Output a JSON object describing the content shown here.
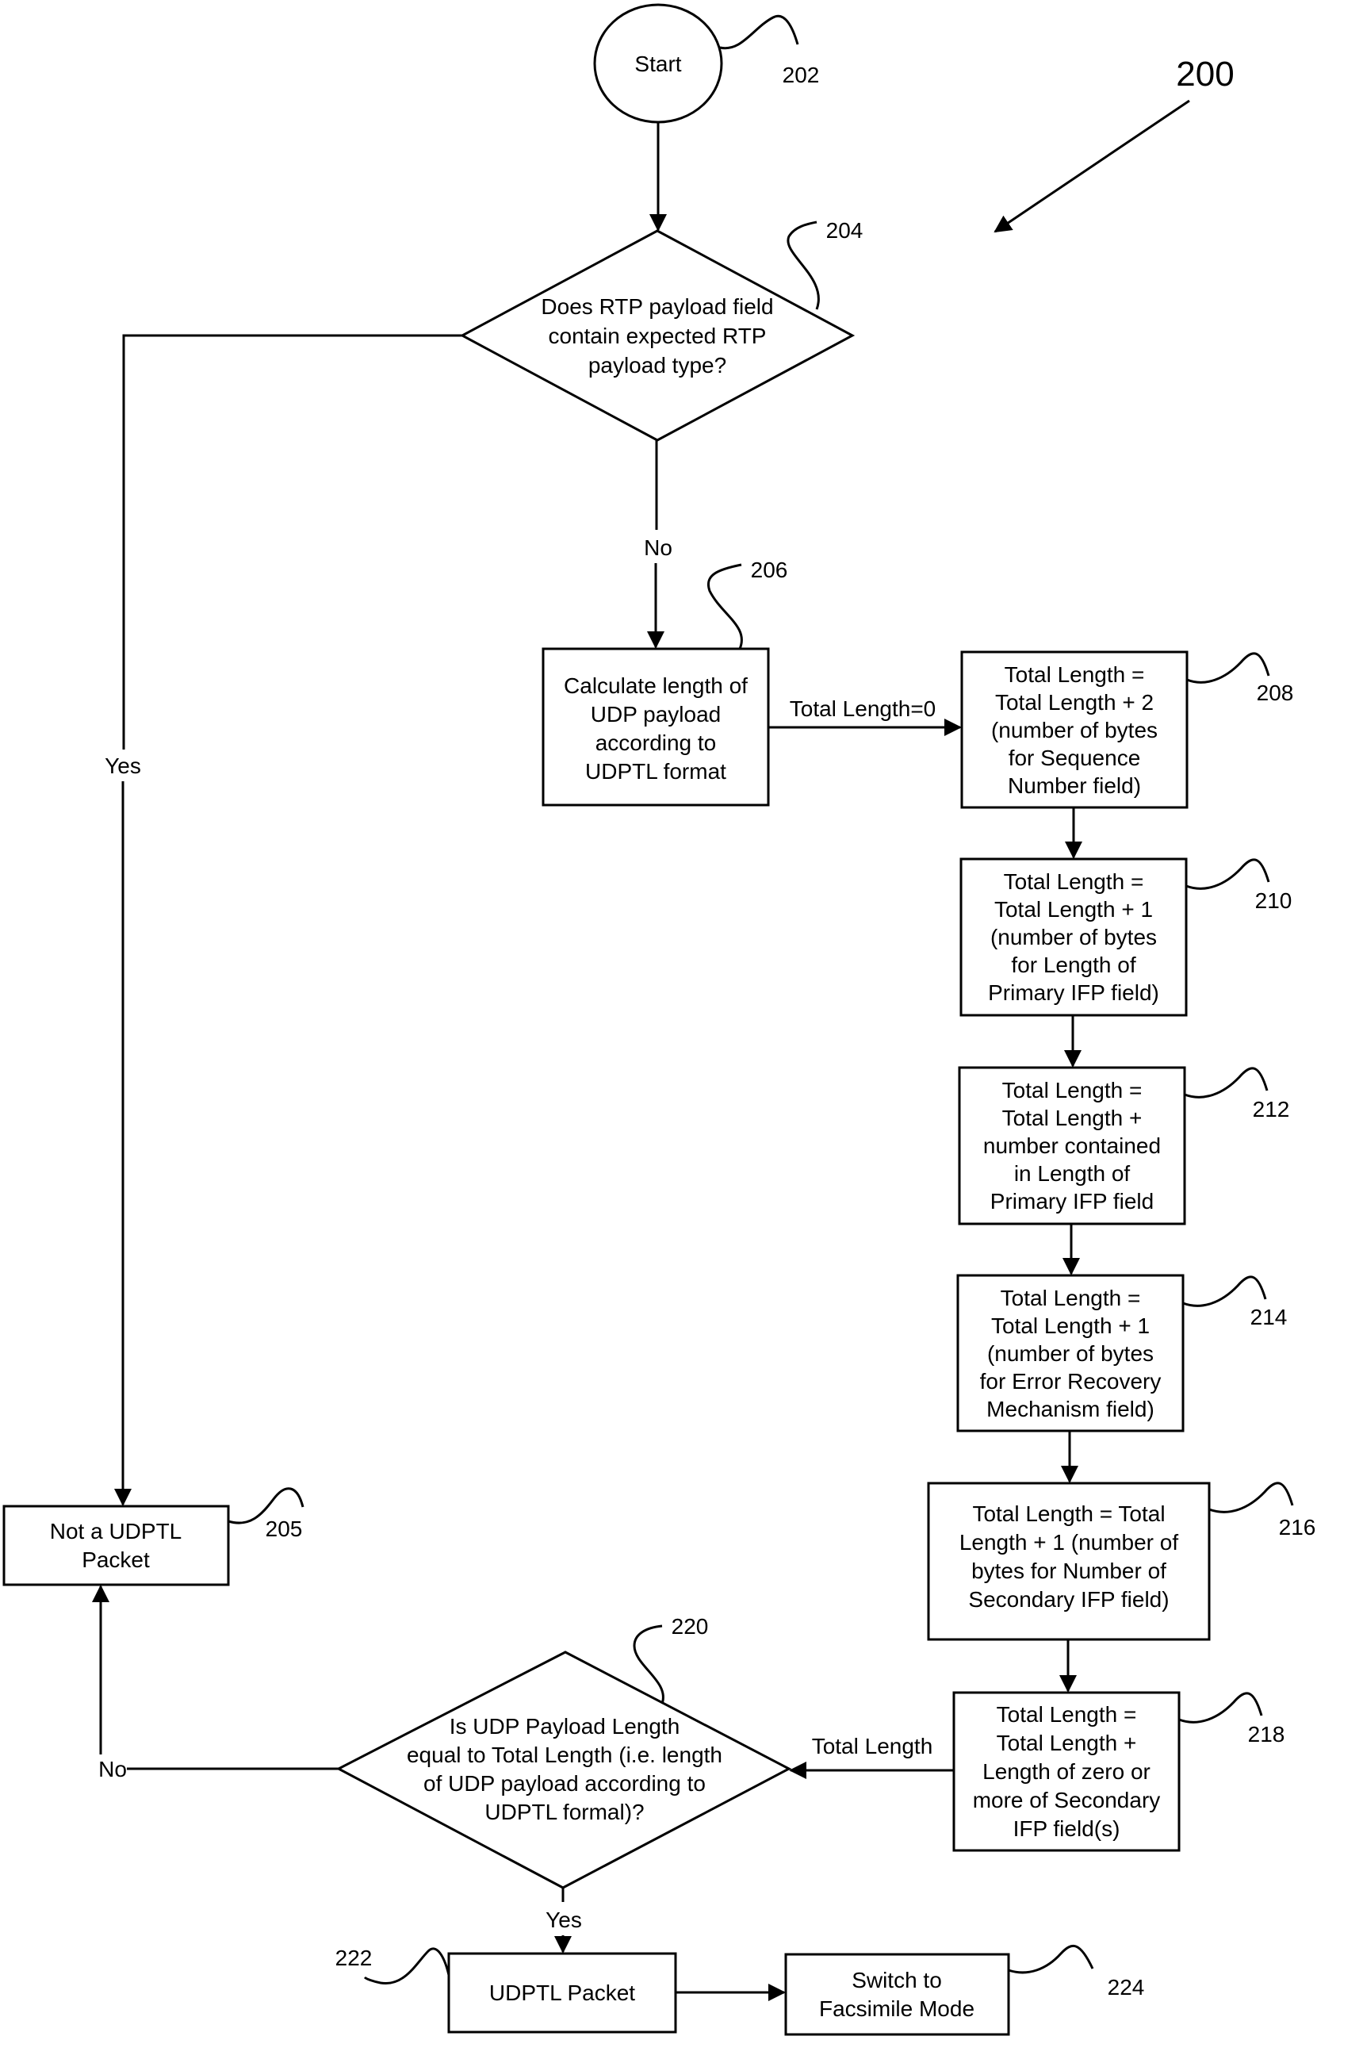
{
  "figure": {
    "reference": "200"
  },
  "nodes": {
    "start": {
      "ref": "202",
      "lines": [
        "Start"
      ]
    },
    "check_rtp": {
      "ref": "204",
      "lines": [
        "Does RTP payload field",
        "contain expected RTP",
        "payload type?"
      ]
    },
    "not_udptl": {
      "ref": "205",
      "lines": [
        "Not a UDPTL",
        "Packet"
      ]
    },
    "calc_length": {
      "ref": "206",
      "lines": [
        "Calculate length of",
        "UDP payload",
        "according to",
        "UDPTL format"
      ]
    },
    "add_seq": {
      "ref": "208",
      "lines": [
        "Total Length =",
        "Total Length + 2",
        "(number of bytes",
        "for Sequence",
        "Number field)"
      ]
    },
    "add_len_primary": {
      "ref": "210",
      "lines": [
        "Total Length =",
        "Total Length + 1",
        "(number of bytes",
        "for Length of",
        "Primary IFP field)"
      ]
    },
    "add_primary": {
      "ref": "212",
      "lines": [
        "Total Length =",
        "Total Length +",
        "number contained",
        "in Length of",
        "Primary IFP field"
      ]
    },
    "add_error_recovery": {
      "ref": "214",
      "lines": [
        "Total Length =",
        "Total Length + 1",
        "(number of bytes",
        "for Error Recovery",
        "Mechanism field)"
      ]
    },
    "add_num_secondary": {
      "ref": "216",
      "lines": [
        "Total Length = Total",
        "Length + 1 (number of",
        "bytes for Number of",
        "Secondary IFP field)"
      ]
    },
    "add_secondary": {
      "ref": "218",
      "lines": [
        "Total Length =",
        "Total Length +",
        "Length of zero or",
        "more of Secondary",
        "IFP field(s)"
      ]
    },
    "compare": {
      "ref": "220",
      "lines": [
        "Is UDP Payload Length",
        "equal to Total Length (i.e. length",
        "of UDP payload according to",
        "UDPTL formal)?"
      ]
    },
    "udptl_packet": {
      "ref": "222",
      "lines": [
        "UDPTL Packet"
      ]
    },
    "fax_mode": {
      "ref": "224",
      "lines": [
        "Switch to",
        "Facsimile Mode"
      ]
    }
  },
  "edge_labels": {
    "rtp_yes": "Yes",
    "rtp_no": "No",
    "init_total": "Total Length=0",
    "pass_total": "Total Length",
    "compare_no": "No",
    "compare_yes": "Yes"
  }
}
